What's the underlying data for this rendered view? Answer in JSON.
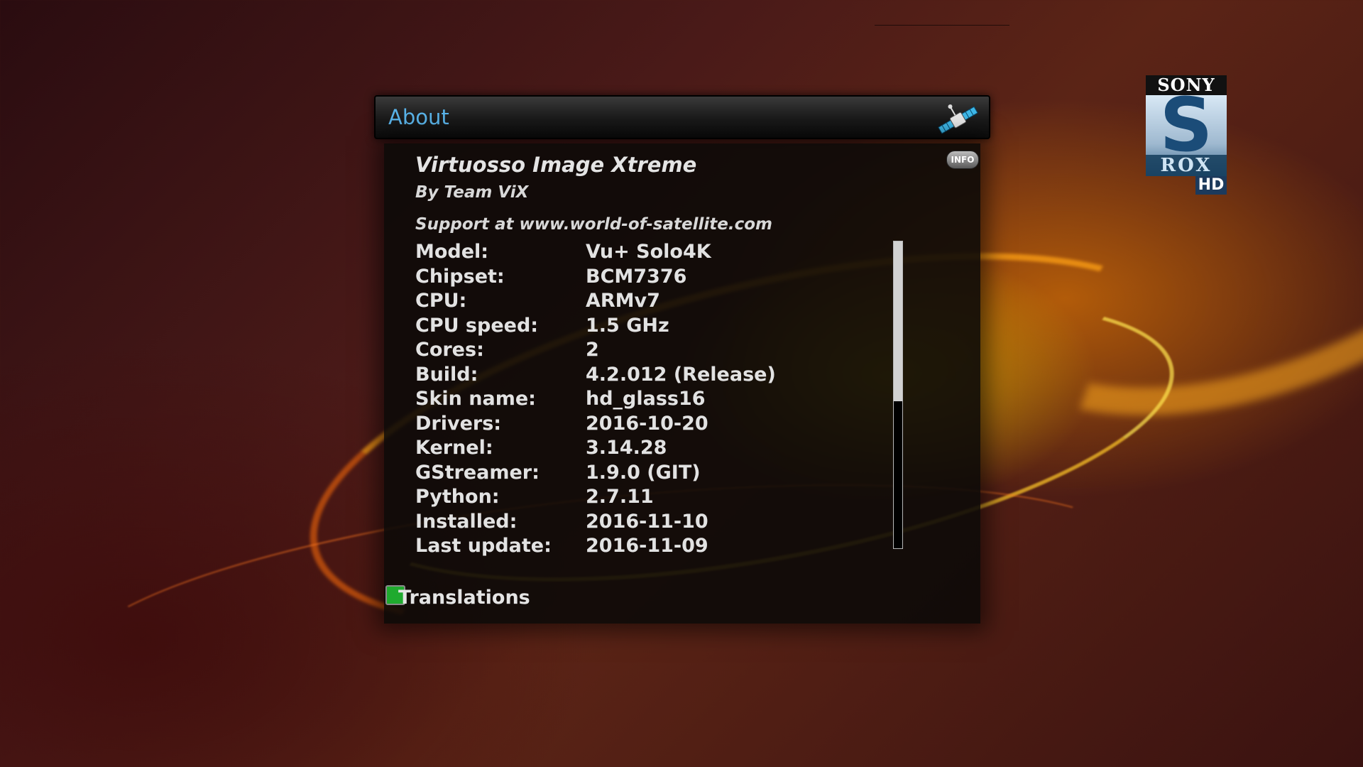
{
  "window": {
    "title": "About",
    "icon": "satellite-icon"
  },
  "image": {
    "name": "Virtuosso Image Xtreme",
    "team": "By Team ViX",
    "support": "Support at www.world-of-satellite.com",
    "info_badge": "INFO"
  },
  "info": [
    {
      "label": "Model:",
      "value": "Vu+ Solo4K"
    },
    {
      "label": "Chipset:",
      "value": "BCM7376"
    },
    {
      "label": "CPU:",
      "value": "ARMv7"
    },
    {
      "label": "CPU speed:",
      "value": "1.5 GHz"
    },
    {
      "label": "Cores:",
      "value": "2"
    },
    {
      "label": "Build:",
      "value": "4.2.012 (Release)"
    },
    {
      "label": "Skin name:",
      "value": "hd_glass16"
    },
    {
      "label": "Drivers:",
      "value": "2016-10-20"
    },
    {
      "label": "Kernel:",
      "value": "3.14.28"
    },
    {
      "label": "GStreamer:",
      "value": "1.9.0 (GIT)"
    },
    {
      "label": "Python:",
      "value": "2.7.11"
    },
    {
      "label": "Installed:",
      "value": "2016-11-10"
    },
    {
      "label": "Last update:",
      "value": "2016-11-09"
    }
  ],
  "scroll": {
    "visible_fraction": 0.52,
    "position": 0.0
  },
  "buttons": {
    "green_key_color": "#1faa2e",
    "translations_label": "Translations"
  },
  "channel_logo": {
    "brand": "SONY",
    "letter": "S",
    "sub": "ROX",
    "tag": "HD"
  },
  "colors": {
    "title": "#5ab4ea",
    "text": "#e2e2e2"
  }
}
